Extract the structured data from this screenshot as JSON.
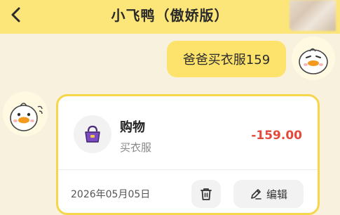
{
  "header": {
    "title": "小飞鸭（傲娇版）",
    "back_icon": "chevron-left-icon",
    "background_color": "#fce67a"
  },
  "chat": {
    "user_message": "爸爸买衣服159"
  },
  "record": {
    "category": "购物",
    "category_icon": "handbag-icon",
    "note": "买衣服",
    "amount": "-159.00",
    "amount_color": "#e34a3b",
    "date": "2026年05月05日",
    "delete_icon": "trash-icon",
    "edit_icon": "pencil-icon",
    "edit_label": "编辑",
    "border_color": "#f6d64a"
  }
}
